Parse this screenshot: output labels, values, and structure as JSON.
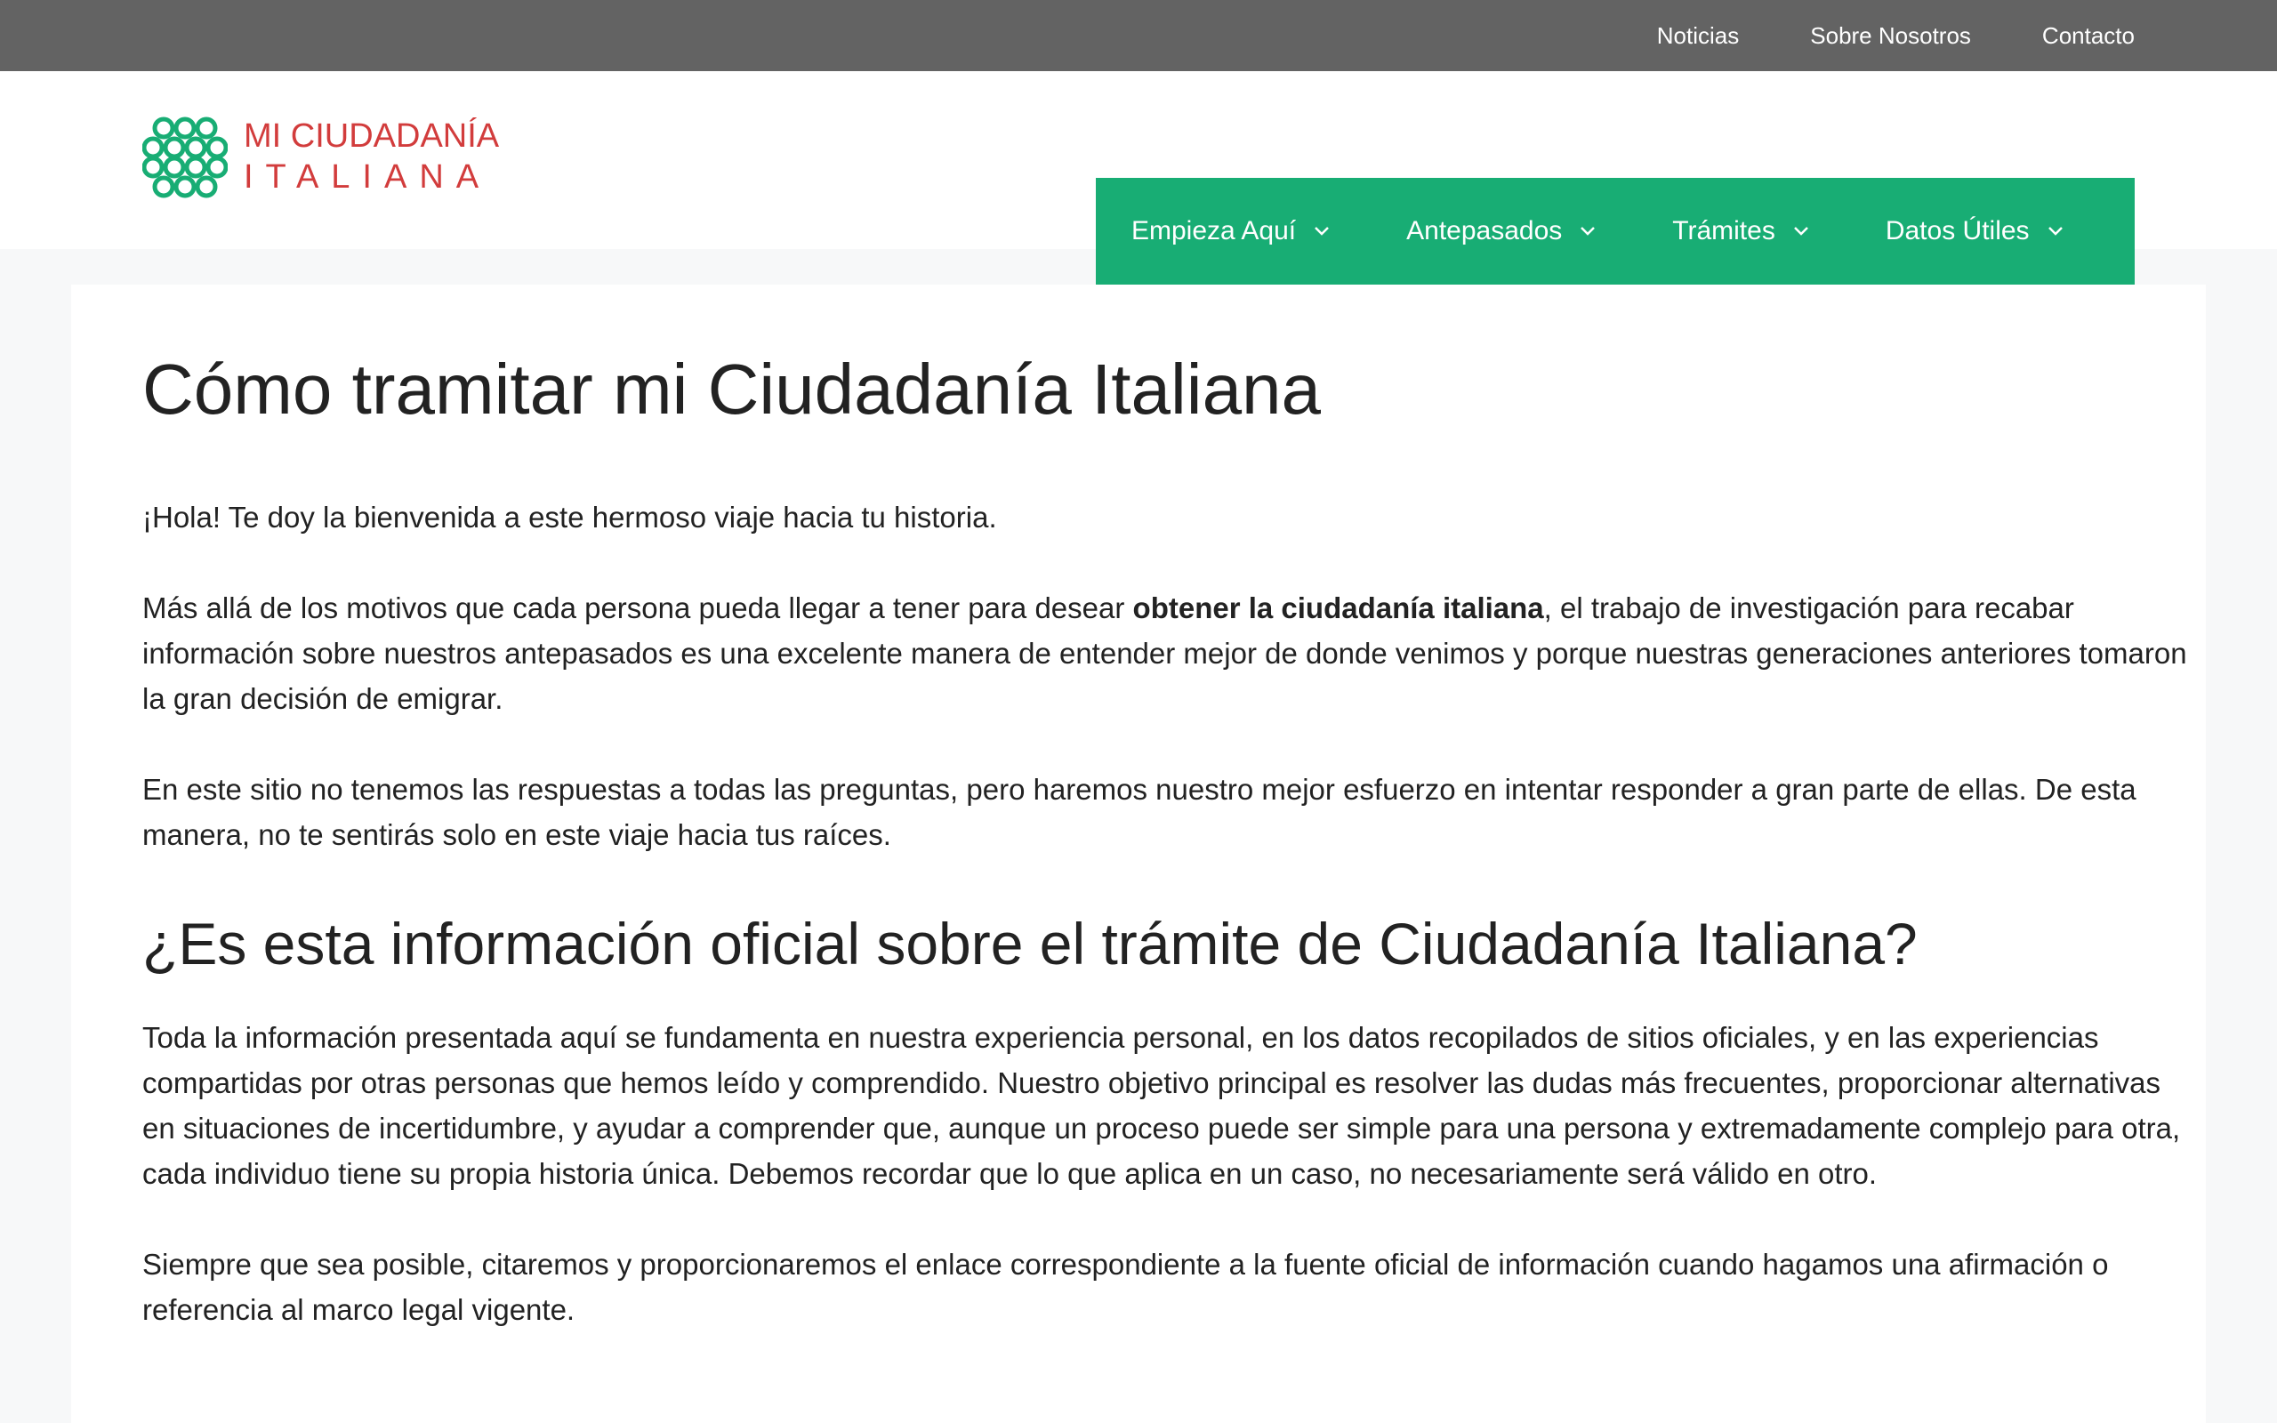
{
  "top_menu": {
    "items": [
      "Noticias",
      "Sobre Nosotros",
      "Contacto"
    ]
  },
  "logo": {
    "line1": "MI CIUDADANÍA",
    "line2": "ITALIANA",
    "icon": "knot-pattern-icon",
    "color_text": "#d23c3c",
    "color_icon": "#18ad74"
  },
  "main_nav": {
    "background": "#18ad74",
    "items": [
      "Empieza Aquí",
      "Antepasados",
      "Trámites",
      "Datos Útiles"
    ]
  },
  "article": {
    "title": "Cómo tramitar mi Ciudadanía Italiana",
    "p1": "¡Hola! Te doy la bienvenida a este hermoso viaje hacia tu historia.",
    "p2_before": "Más allá de los motivos que cada persona pueda llegar a tener para desear ",
    "p2_bold": "obtener la ciudadanía italiana",
    "p2_after": ", el trabajo de investigación para recabar información sobre nuestros antepasados es una excelente manera de entender mejor de donde venimos y porque nuestras generaciones anteriores tomaron la gran decisión de emigrar.",
    "p3": "En este sitio no tenemos las respuestas a todas las preguntas, pero haremos nuestro mejor esfuerzo en intentar responder a gran parte de ellas. De esta manera, no te sentirás solo en este viaje hacia tus raíces.",
    "subtitle": "¿Es esta información oficial sobre el trámite de Ciudadanía Italiana?",
    "p4": "Toda la información presentada aquí se fundamenta en nuestra experiencia personal, en los datos recopilados de sitios oficiales, y en las experiencias compartidas por otras personas que hemos leído y comprendido. Nuestro objetivo principal es resolver las dudas más frecuentes, proporcionar alternativas en situaciones de incertidumbre, y ayudar a comprender que, aunque un proceso puede ser simple para una persona y extremadamente complejo para otra, cada individuo tiene su propia historia única. Debemos recordar que lo que aplica en un caso, no necesariamente será válido en otro.",
    "p5": "Siempre que sea posible, citaremos y proporcionaremos el enlace correspondiente a la fuente oficial de información cuando hagamos una afirmación o referencia al marco legal vigente."
  }
}
